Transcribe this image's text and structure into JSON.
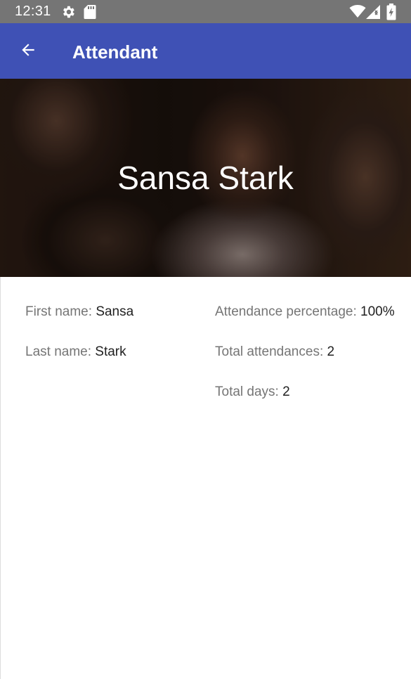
{
  "status_bar": {
    "time": "12:31",
    "icons": [
      "settings-icon",
      "sd-card-icon",
      "wifi-icon",
      "signal-icon",
      "battery-charging-icon"
    ]
  },
  "app_bar": {
    "title": "Attendant",
    "back_icon": "arrow-back-icon",
    "color": "#3f51b5"
  },
  "header": {
    "full_name": "Sansa Stark"
  },
  "details": {
    "first_name": {
      "label": "First name: ",
      "value": "Sansa"
    },
    "last_name": {
      "label": "Last name: ",
      "value": "Stark"
    },
    "attendance_percentage": {
      "label": "Attendance percentage: ",
      "value": "100%"
    },
    "total_attendances": {
      "label": "Total attendances: ",
      "value": "2"
    },
    "total_days": {
      "label": "Total days: ",
      "value": "2"
    }
  }
}
